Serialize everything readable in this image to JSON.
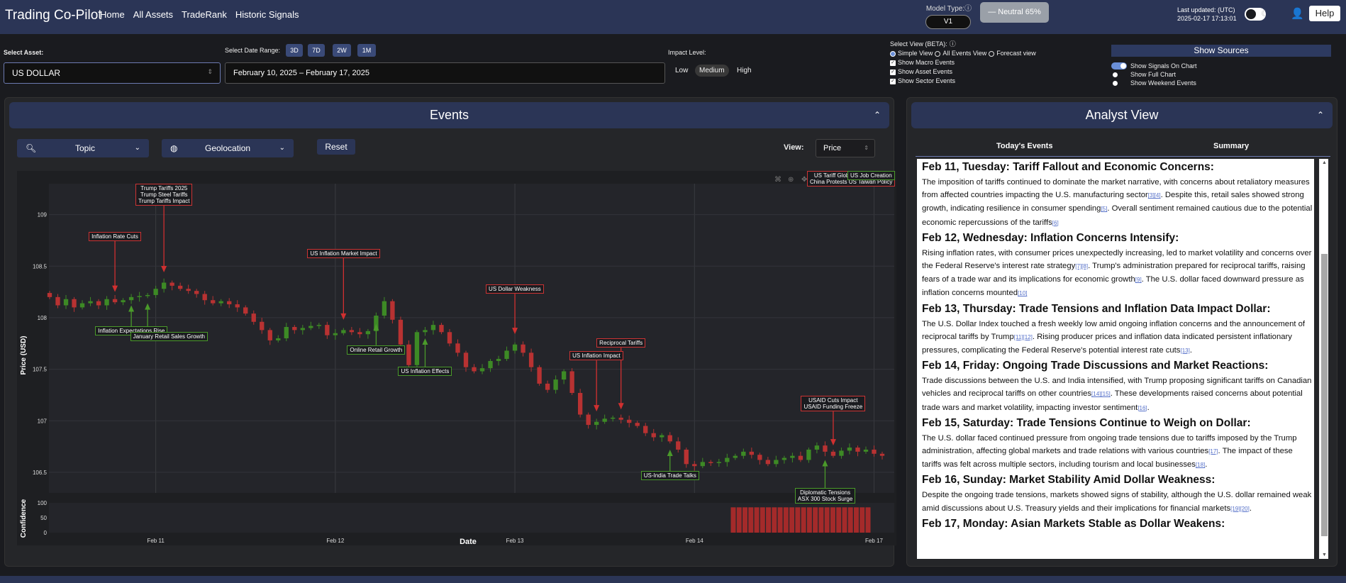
{
  "app": {
    "title": "Trading Co-Pilot",
    "nav": [
      "Home",
      "All Assets",
      "TradeRank",
      "Historic Signals"
    ],
    "model_type_label": "Model Type:",
    "model_value": "V1",
    "sentiment": "Neutral 65%",
    "last_updated_label": "Last updated: (UTC)",
    "last_updated_value": "2025-02-17 17:13:01",
    "help_label": "Help"
  },
  "controls": {
    "asset_label": "Select Asset:",
    "asset_value": "US DOLLAR",
    "date_range_label": "Select Date Range:",
    "date_buttons": [
      "3D",
      "7D",
      "2W",
      "1M"
    ],
    "date_value": "February 10, 2025 – February 17, 2025",
    "impact_label": "Impact Level:",
    "impact_levels": [
      "Low",
      "Medium",
      "High"
    ],
    "impact_selected": "Medium",
    "view_label": "Select View (BETA):",
    "views": [
      "Simple View",
      "All Events View",
      "Forecast view"
    ],
    "checks": [
      "Show Macro Events",
      "Show Asset Events",
      "Show Sector Events"
    ],
    "show_sources_label": "Show Sources",
    "signal_opts": [
      "Show Signals On Chart",
      "Show Full Chart",
      "Show Weekend Events"
    ]
  },
  "events": {
    "title": "Events",
    "topic_label": "Topic",
    "geo_label": "Geolocation",
    "reset_label": "Reset",
    "view_label": "View:",
    "view_value": "Price"
  },
  "chart_data": {
    "type": "candlestick",
    "ylabel": "Price (USD)",
    "xlabel": "Date",
    "conf_label": "Confidence",
    "ylim": [
      106.3,
      109.3
    ],
    "y_ticks": [
      109,
      108.5,
      108,
      107.5,
      107,
      106.5
    ],
    "conf_ticks": [
      100,
      50,
      0
    ],
    "x_ticks": [
      "Feb 11",
      "Feb 12",
      "Feb 13",
      "Feb 14",
      "Feb 17"
    ],
    "x_sub": "2025",
    "bearish_color": "#b83232",
    "bullish_color": "#3d8a25",
    "closes": [
      108.2,
      108.12,
      108.18,
      108.1,
      108.14,
      108.16,
      108.12,
      108.18,
      108.15,
      108.17,
      108.2,
      108.21,
      108.22,
      108.28,
      108.34,
      108.31,
      108.28,
      108.26,
      108.23,
      108.17,
      108.14,
      108.16,
      108.13,
      108.1,
      108.04,
      107.96,
      107.88,
      107.78,
      107.8,
      107.91,
      107.88,
      107.9,
      107.92,
      107.93,
      107.83,
      107.85,
      107.88,
      107.86,
      107.84,
      107.87,
      108.02,
      108.16,
      107.98,
      107.74,
      107.54,
      107.86,
      107.88,
      107.93,
      107.86,
      107.75,
      107.66,
      107.52,
      107.48,
      107.51,
      107.58,
      107.6,
      107.68,
      107.74,
      107.66,
      107.52,
      107.36,
      107.3,
      107.4,
      107.48,
      107.27,
      107.06,
      106.96,
      106.99,
      107.02,
      107.03,
      107.01,
      106.98,
      106.95,
      106.88,
      106.84,
      106.86,
      106.8,
      106.72,
      106.58,
      106.56,
      106.6,
      106.59,
      106.6,
      106.64,
      106.66,
      106.7,
      106.67,
      106.62,
      106.58,
      106.62,
      106.64,
      106.66,
      106.62,
      106.72,
      106.76,
      106.7,
      106.66,
      106.71,
      106.74,
      106.7,
      106.72,
      106.68,
      106.66
    ],
    "confidence": [
      85,
      85,
      85,
      85,
      85,
      85,
      85,
      85,
      85,
      85,
      85,
      85,
      85,
      85,
      85,
      85,
      85,
      85,
      85,
      85,
      85,
      85,
      85,
      85
    ],
    "bearish_signals": [
      {
        "label": [
          "Trump Tariffs 2025",
          "Trump Steel Tariffs",
          "Trump Tariffs Impact"
        ],
        "i": 14
      },
      {
        "label": [
          "Inflation Rate Cuts"
        ],
        "i": 8
      },
      {
        "label": [
          "US Inflation Market Impact"
        ],
        "i": 36
      },
      {
        "label": [
          "US Dollar Weakness"
        ],
        "i": 57
      },
      {
        "label": [
          "US Inflation Impact"
        ],
        "i": 67
      },
      {
        "label": [
          "Reciprocal Tariffs"
        ],
        "i": 70
      },
      {
        "label": [
          "USAID Cuts Impact",
          "USAID Funding Freeze"
        ],
        "i": 96
      },
      {
        "label": [
          "US Tariff Global Trade Impact",
          "China Protests US Taiwan Policy"
        ],
        "i": 108
      }
    ],
    "bullish_signals": [
      {
        "label": [
          "Inflation Expectations Rise"
        ],
        "i": 10
      },
      {
        "label": [
          "January Retail Sales Growth"
        ],
        "i": 12
      },
      {
        "label": [
          "Online Retail Growth"
        ],
        "i": 40
      },
      {
        "label": [
          "US Inflation Effects"
        ],
        "i": 46
      },
      {
        "label": [
          "US-India Trade Talks"
        ],
        "i": 76
      },
      {
        "label": [
          "Diplomatic Tensions",
          "ASX 300 Stock Surge"
        ],
        "i": 95
      },
      {
        "label": [
          "US Job Creation"
        ],
        "i": 107
      }
    ]
  },
  "analyst": {
    "title": "Analyst View",
    "tabs": [
      "Today's Events",
      "Summary"
    ],
    "entries": [
      {
        "heading": "Feb 11, Tuesday: Tariff Fallout and Economic Concerns",
        "text": "The imposition of tariffs continued to dominate the market narrative, with concerns about retaliatory measures from affected countries impacting the U.S. manufacturing sector",
        "c1": "[3][4]",
        "text2": ". Despite this, retail sales showed strong growth, indicating resilience in consumer spending",
        "c2": "[5]",
        "text3": ". Overall sentiment remained cautious due to the potential economic repercussions of the tariffs",
        "c3": "[6]"
      },
      {
        "heading": "Feb 12, Wednesday: Inflation Concerns Intensify",
        "text": "Rising inflation rates, with consumer prices unexpectedly increasing, led to market volatility and concerns over the Federal Reserve's interest rate strategy",
        "c1": "[7][8]",
        "text2": ". Trump's administration prepared for reciprocal tariffs, raising fears of a trade war and its implications for economic growth",
        "c2": "[9]",
        "text3": ". The U.S. dollar faced downward pressure as inflation concerns mounted",
        "c3": "[10]"
      },
      {
        "heading": "Feb 13, Thursday: Trade Tensions and Inflation Data Impact Dollar",
        "text": "The U.S. Dollar Index touched a fresh weekly low amid ongoing inflation concerns and the announcement of reciprocal tariffs by Trump",
        "c1": "[11][12]",
        "text2": ". Rising producer prices and inflation data indicated persistent inflationary pressures, complicating the Federal Reserve's potential interest rate cuts",
        "c2": "[13]",
        "text3": ".",
        "c3": ""
      },
      {
        "heading": "Feb 14, Friday: Ongoing Trade Discussions and Market Reactions",
        "text": "Trade discussions between the U.S. and India intensified, with Trump proposing significant tariffs on Canadian vehicles and reciprocal tariffs on other countries",
        "c1": "[14][15]",
        "text2": ". These developments raised concerns about potential trade wars and market volatility, impacting investor sentiment",
        "c2": "[16]",
        "text3": ".",
        "c3": ""
      },
      {
        "heading": "Feb 15, Saturday: Trade Tensions Continue to Weigh on Dollar",
        "text": "The U.S. dollar faced continued pressure from ongoing trade tensions due to tariffs imposed by the Trump administration, affecting global markets and trade relations with various countries",
        "c1": "[17]",
        "text2": ". The impact of these tariffs was felt across multiple sectors, including tourism and local businesses",
        "c2": "[18]",
        "text3": ".",
        "c3": ""
      },
      {
        "heading": "Feb 16, Sunday: Market Stability Amid Dollar Weakness",
        "text": "Despite the ongoing trade tensions, markets showed signs of stability, although the U.S. dollar remained weak amid discussions about U.S. Treasury yields and their implications for financial markets",
        "c1": "[19][20]",
        "text2": ".",
        "c2": "",
        "text3": "",
        "c3": ""
      },
      {
        "heading": "Feb 17, Monday: Asian Markets Stable as Dollar Weakens",
        "text": "",
        "c1": "",
        "text2": "",
        "c2": "",
        "text3": "",
        "c3": ""
      }
    ]
  }
}
